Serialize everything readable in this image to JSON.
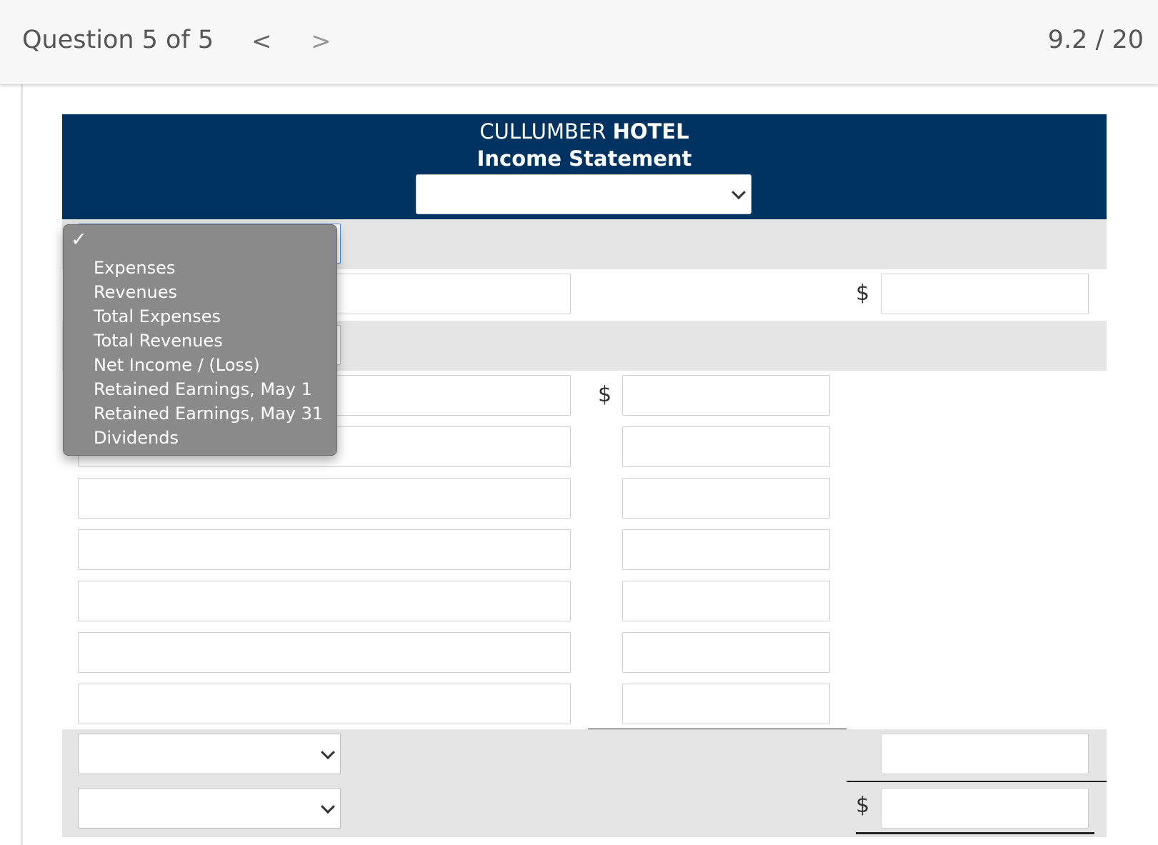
{
  "header": {
    "question_label": "Question 5 of 5",
    "prev_glyph": "<",
    "next_glyph": ">",
    "score": "9.2 / 20"
  },
  "statement": {
    "company_part1": "CULLUMBER",
    "company_part2": "HOTEL",
    "title": "Income Statement",
    "period_selected": ""
  },
  "currency_symbol": "$",
  "dropdown": {
    "checkmark": "✓",
    "options": [
      "Expenses",
      "Revenues",
      "Total Expenses",
      "Total Revenues",
      "Net Income / (Loss)",
      "Retained Earnings, May 1",
      "Retained Earnings, May 31",
      "Dividends"
    ]
  },
  "colors": {
    "header_band": "#003361",
    "band_gray": "#e5e5e5",
    "menu_bg": "#8a8a8a"
  }
}
